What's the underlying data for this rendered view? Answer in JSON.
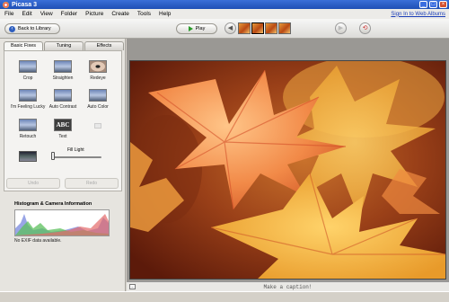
{
  "window": {
    "title": "Picasa 3"
  },
  "menu": {
    "items": [
      "File",
      "Edit",
      "View",
      "Folder",
      "Picture",
      "Create",
      "Tools",
      "Help"
    ],
    "signin": "Sign In to Web Albums"
  },
  "toolbar": {
    "back_label": "Back to Library",
    "play_label": "Play"
  },
  "tabs": [
    "Basic Fixes",
    "Tuning",
    "Effects"
  ],
  "tools": [
    {
      "label": "Crop"
    },
    {
      "label": "Straighten"
    },
    {
      "label": "Redeye"
    },
    {
      "label": "I'm Feeling Lucky"
    },
    {
      "label": "Auto Contrast"
    },
    {
      "label": "Auto Color"
    },
    {
      "label": "Retouch"
    },
    {
      "label": "Text",
      "icon_text": "ABC"
    }
  ],
  "fill_light": {
    "label": "Fill Light",
    "level": 0
  },
  "actions": {
    "undo": "Undo",
    "redo": "Redo"
  },
  "histogram": {
    "title": "Histogram & Camera Information",
    "exif": "No EXIF data available."
  },
  "caption": {
    "placeholder": "Make a caption!"
  },
  "colors": {
    "title_bar": "#2a5cc9",
    "photo_bg": "#8c3a1a",
    "leaf": "#f2904a"
  }
}
